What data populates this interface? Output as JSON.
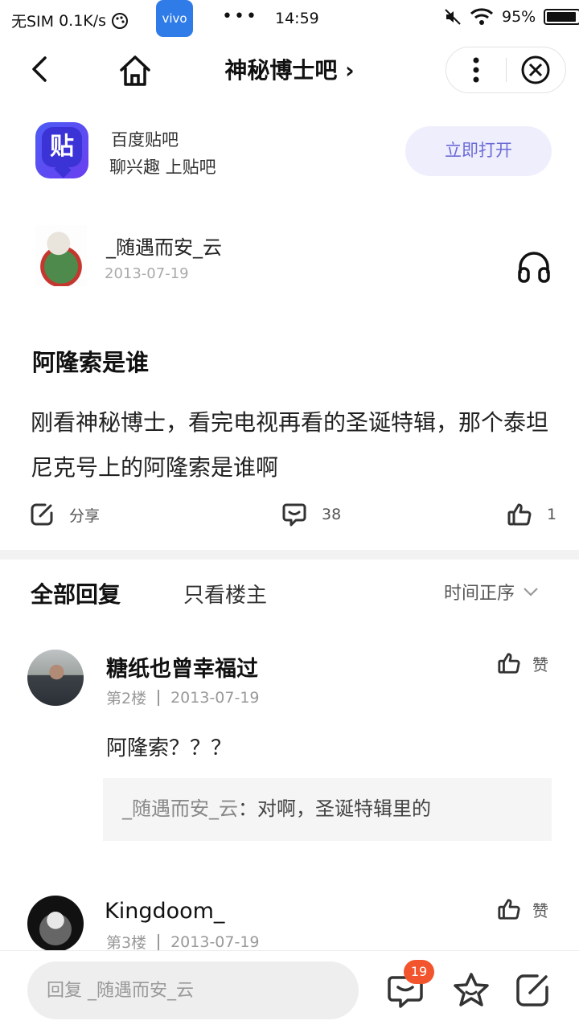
{
  "status_bar": {
    "sim": "无SIM",
    "speed": "0.1K/s",
    "vivo": "vivo",
    "dots": "•••",
    "time": "14:59",
    "battery": "95%",
    "battery_level": 0.95
  },
  "nav": {
    "title": "神秘博士吧",
    "title_arrow": "›"
  },
  "app_banner": {
    "icon_text": "贴",
    "name": "百度贴吧",
    "slogan": "聊兴趣 上贴吧",
    "open_label": "立即打开"
  },
  "post": {
    "author": "_随遇而安_云",
    "date": "2013-07-19",
    "title": "阿隆索是谁",
    "body": "刚看神秘博士，看完电视再看的圣诞特辑，那个泰坦尼克号上的阿隆索是谁啊",
    "share_label": "分享",
    "comment_count": "38",
    "like_count": "1"
  },
  "tabs": {
    "all": "全部回复",
    "only_op": "只看楼主",
    "sort": "时间正序"
  },
  "replies": [
    {
      "name": "糖纸也曾幸福过",
      "floor": "第2楼",
      "date": "2013-07-19",
      "like_label": "赞",
      "text": "阿隆索？？？",
      "quote_name": "_随遇而安_云",
      "quote_sep": "：",
      "quote_text": "对啊，圣诞特辑里的"
    },
    {
      "name": "Kingdoom_",
      "floor": "第3楼",
      "date": "2013-07-19",
      "like_label": "赞"
    }
  ],
  "bottom_bar": {
    "reply_placeholder": "回复 _随遇而安_云",
    "comment_badge": "19"
  }
}
